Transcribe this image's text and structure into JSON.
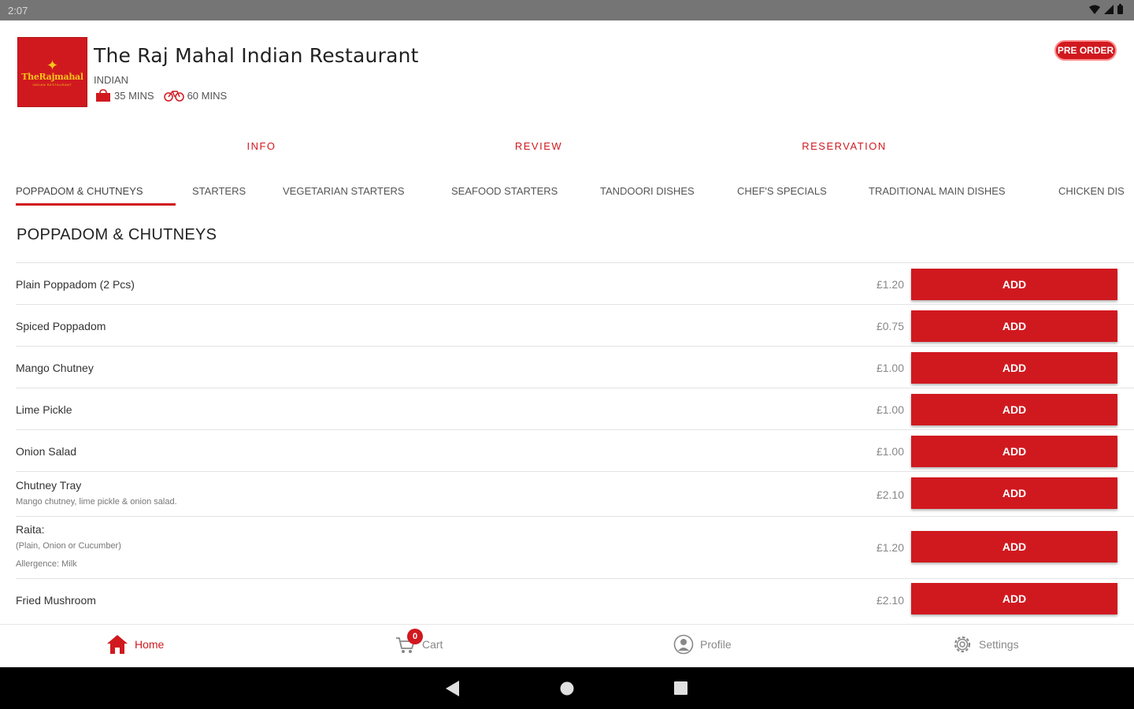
{
  "status_bar": {
    "time": "2:07"
  },
  "restaurant": {
    "logo_text": "TheRajmahal",
    "logo_subtext": "INDIAN RESTAURANT",
    "name": "The Raj Mahal Indian Restaurant",
    "cuisine": "INDIAN",
    "collection_time": "35 MINS",
    "delivery_time": "60 MINS",
    "pre_order_label": "PRE ORDER"
  },
  "top_tabs": [
    "INFO",
    "REVIEW",
    "RESERVATION"
  ],
  "category_tabs": [
    "POPPADOM & CHUTNEYS",
    "STARTERS",
    "VEGETARIAN STARTERS",
    "SEAFOOD STARTERS",
    "TANDOORI DISHES",
    "CHEF'S SPECIALS",
    "TRADITIONAL MAIN DISHES",
    "CHICKEN DIS"
  ],
  "active_category": "POPPADOM & CHUTNEYS",
  "section_title": "POPPADOM & CHUTNEYS",
  "add_label": "ADD",
  "menu_items": [
    {
      "name": "Plain Poppadom (2 Pcs)",
      "desc": [],
      "price": "£1.20"
    },
    {
      "name": "Spiced Poppadom",
      "desc": [],
      "price": "£0.75"
    },
    {
      "name": "Mango Chutney",
      "desc": [],
      "price": "£1.00"
    },
    {
      "name": "Lime Pickle",
      "desc": [],
      "price": "£1.00"
    },
    {
      "name": "Onion Salad",
      "desc": [],
      "price": "£1.00"
    },
    {
      "name": "Chutney Tray",
      "desc": [
        "Mango chutney, lime pickle & onion salad."
      ],
      "price": "£2.10"
    },
    {
      "name": "Raita:",
      "desc": [
        "(Plain, Onion or Cucumber)",
        "Allergence: Milk"
      ],
      "price": "£1.20"
    },
    {
      "name": "Fried Mushroom",
      "desc": [],
      "price": "£2.10"
    }
  ],
  "bottom_nav": {
    "home": "Home",
    "cart": "Cart",
    "cart_count": "0",
    "profile": "Profile",
    "settings": "Settings"
  },
  "colors": {
    "accent": "#d0191f",
    "status_bar": "#757575",
    "logo_gold": "#f7c31c"
  }
}
